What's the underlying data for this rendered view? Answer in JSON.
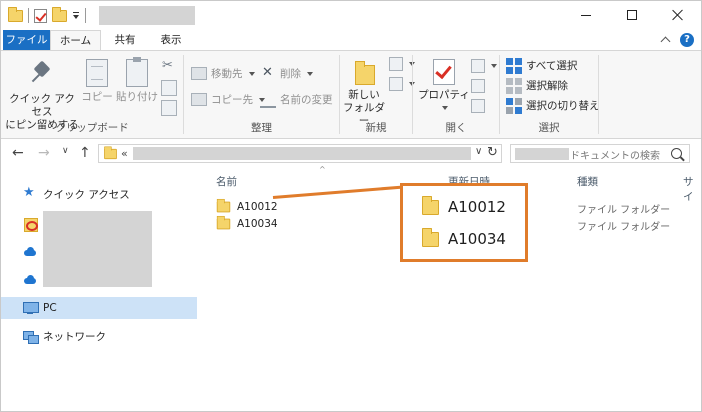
{
  "ribbon_tabs": {
    "file": "ファイル",
    "home": "ホーム",
    "share": "共有",
    "view": "表示"
  },
  "help_glyph": "?",
  "clipboard": {
    "pin": [
      "クイック アクセス",
      "にピン留めする"
    ],
    "copy": "コピー",
    "paste": "貼り付け",
    "label": "クリップボード"
  },
  "organize": {
    "move_to": "移動先",
    "copy_to": "コピー先",
    "delete": "削除",
    "rename": "名前の変更",
    "label": "整理"
  },
  "new_group": {
    "new_folder": [
      "新しい",
      "フォルダー"
    ],
    "label": "新規"
  },
  "open_group": {
    "properties": "プロパティ",
    "label": "開く"
  },
  "select_group": {
    "select_all": "すべて選択",
    "select_none": "選択解除",
    "invert": "選択の切り替え",
    "label": "選択"
  },
  "address": {
    "prefix": "«",
    "search_placeholder": "ドキュメントの検索"
  },
  "nav_pane": {
    "quick_access": "クイック アクセス",
    "pc": "PC",
    "network": "ネットワーク"
  },
  "columns": {
    "name": "名前",
    "date": "更新日時",
    "type": "種類",
    "size": "サイ"
  },
  "files": [
    {
      "name": "A10012",
      "type": "ファイル フォルダー"
    },
    {
      "name": "A10034",
      "type": "ファイル フォルダー"
    }
  ],
  "callout_files": [
    "A10012",
    "A10034"
  ],
  "colors": {
    "accent": "#1a6fc4",
    "callout": "#e07c2b",
    "selection": "#cde2f7",
    "folder": "#f5d46a"
  }
}
